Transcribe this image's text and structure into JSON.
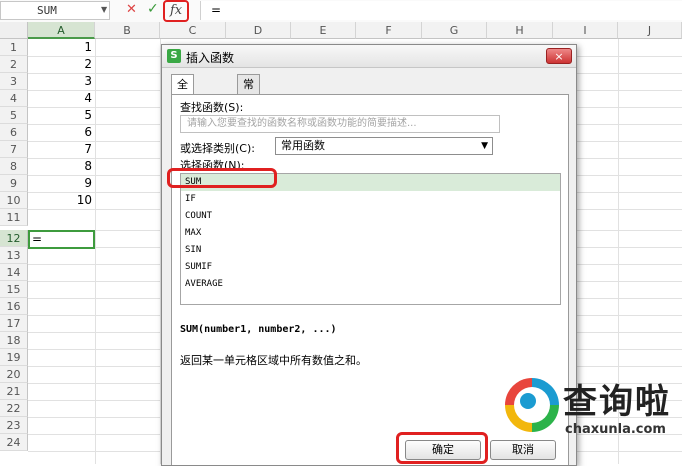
{
  "formula_bar": {
    "name_box": "SUM",
    "cancel_icon": "close-icon",
    "confirm_icon": "check-icon",
    "fx_label": "fx",
    "formula_value": "="
  },
  "grid": {
    "columns": [
      "A",
      "B",
      "C",
      "D",
      "E",
      "F",
      "G",
      "H",
      "I",
      "J"
    ],
    "rows": [
      "1",
      "2",
      "3",
      "4",
      "5",
      "6",
      "7",
      "8",
      "9",
      "10",
      "11",
      "12",
      "13",
      "14",
      "15",
      "16",
      "17",
      "18",
      "19",
      "20",
      "21",
      "22",
      "23",
      "24"
    ],
    "values": [
      "1",
      "2",
      "3",
      "4",
      "5",
      "6",
      "7",
      "8",
      "9",
      "10"
    ],
    "active_cell_value": "="
  },
  "dialog": {
    "title": "插入函数",
    "close_label": "×",
    "tabs": [
      {
        "label": "全部函数"
      },
      {
        "label": "常用公式"
      }
    ],
    "search_label": "查找函数(S):",
    "search_placeholder": "请输入您要查找的函数名称或函数功能的简要描述...",
    "category_label": "或选择类别(C):",
    "category_value": "常用函数",
    "select_label": "选择函数(N):",
    "functions": [
      "SUM",
      "IF",
      "COUNT",
      "MAX",
      "SIN",
      "SUMIF",
      "AVERAGE"
    ],
    "selected_function": "SUM",
    "syntax": "SUM(number1, number2, ...)",
    "description": "返回某一单元格区域中所有数值之和。",
    "ok_label": "确定",
    "cancel_label": "取消"
  },
  "watermark": {
    "text": "查询啦",
    "url": "chaxunla.com"
  },
  "colors": {
    "highlight": "#e02020",
    "selection_green": "#3e9b3e",
    "dialog_bg": "#f0f0f0"
  }
}
